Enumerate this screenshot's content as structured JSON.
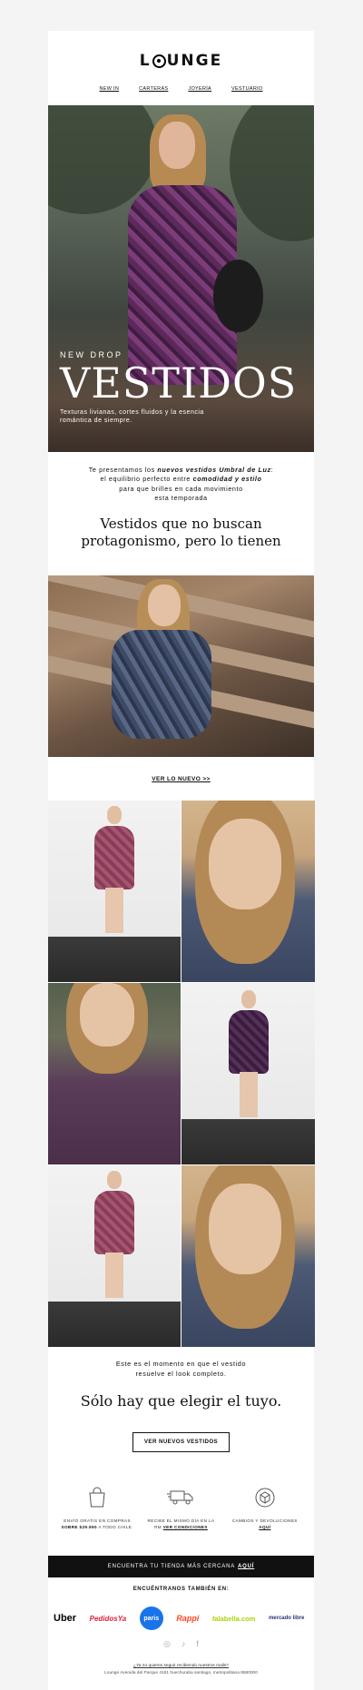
{
  "brand": {
    "logo_text": "LOUNGE"
  },
  "nav": {
    "items": [
      "NEW IN",
      "CARTERAS",
      "JOYERÍA",
      "VESTUARIO"
    ]
  },
  "hero": {
    "kicker": "NEW DROP",
    "title": "VESTIDOS",
    "subtitle": "Texturas livianas, cortes fluidos y la esencia romántica de siempre."
  },
  "intro": {
    "line1_a": "Te presentamos los ",
    "line1_em": "nuevos vestidos Umbral de Luz",
    "line1_b": ":",
    "line2_a": "el equilibrio perfecto entre ",
    "line2_em": "comodidad y estilo",
    "line3": "para que brilles en cada movimiento",
    "line4": "esta temporada"
  },
  "heading": {
    "line1": "Vestidos que no buscan",
    "line2": "protagonismo, pero lo tienen"
  },
  "cta_link": {
    "label": "VER LO NUEVO >>"
  },
  "closing": {
    "line1": "Este es el momento en que el vestido",
    "line2": "resuelve el look completo.",
    "heading": "Sólo hay que elegir el tuyo.",
    "button": "VER NUEVOS VESTIDOS"
  },
  "benefits": [
    {
      "icon": "shopping-bag-icon",
      "line1": "ENVÍO GRATIS EN COMPRAS",
      "bold": "SOBRE $29.990",
      "line2_rest": " A TODO CHILE."
    },
    {
      "icon": "delivery-truck-icon",
      "line1": "RECIBE EL MISMO DÍA EN LA",
      "line2_pre": "RM ",
      "link": "VER CONDICIONES"
    },
    {
      "icon": "returns-box-icon",
      "line1": "CAMBIOS Y DEVOLUCIONES",
      "link": "AQUÍ"
    }
  ],
  "store_bar": {
    "text": "ENCUENTRA TU TIENDA MÁS CERCANA",
    "link": "AQUÍ"
  },
  "find_us": {
    "title": "ENCUÉNTRANOS TAMBIÉN EN:"
  },
  "partners": [
    {
      "name": "Uber",
      "color": "#000000"
    },
    {
      "name": "PedidosYa",
      "color": "#e0203a"
    },
    {
      "name": "paris",
      "color": "#1a73e8"
    },
    {
      "name": "Rappi",
      "color": "#ff441f"
    },
    {
      "name": "falabella.com",
      "color": "#aad500"
    },
    {
      "name": "mercado libre",
      "color": "#2d3277"
    }
  ],
  "social": [
    "instagram-icon",
    "tiktok-icon",
    "facebook-icon"
  ],
  "footer": {
    "line1": "¿Ya no quieres seguir recibiendo nuestros mails?",
    "line2": "Lounge Avenida del Parque 4161 huechuraba santiago, metropolitana 8580000"
  }
}
